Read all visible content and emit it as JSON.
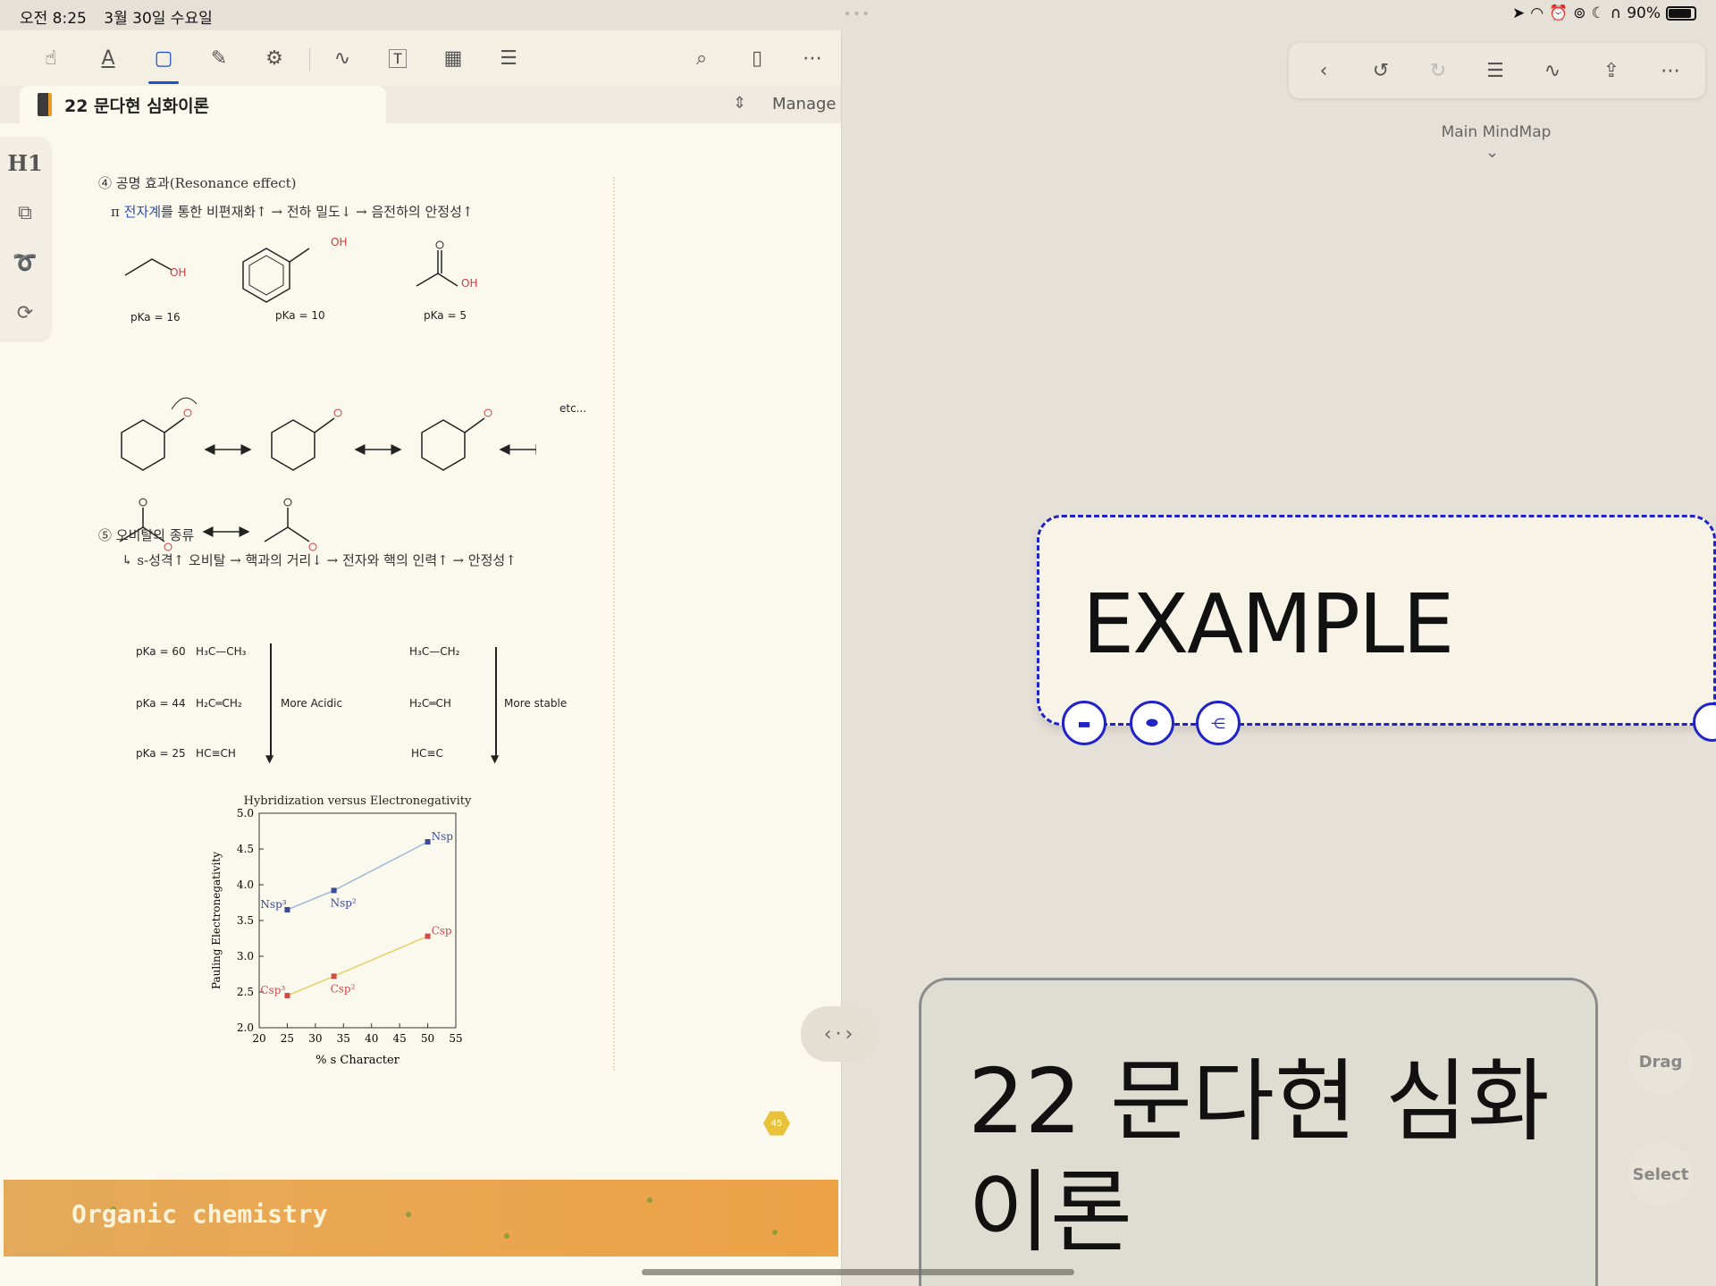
{
  "status": {
    "time": "오전 8:25",
    "date": "3월 30일 수요일",
    "battery": "90%",
    "battery_level": 0.9
  },
  "doc": {
    "tab_title": "22 문다현 심화이론",
    "manage_label": "Manage",
    "toolbar_icons": [
      "hand-icon",
      "highlighter-icon",
      "select-rect-icon",
      "shape-icon",
      "settings-icon",
      "pen-icon",
      "textbox-icon",
      "image-icon",
      "outline-icon",
      "search-icon",
      "bookmark-icon",
      "more-icon"
    ],
    "side_tools": {
      "h1": "H1"
    },
    "page": {
      "section4_title": "④ 공명 효과(Resonance effect)",
      "section4_note_prefix": "π ",
      "section4_note_blue": "전자계",
      "section4_note_rest": "를 통한 비편재화↑ → 전하 밀도↓ → 음전하의 안정성↑",
      "molecules": [
        {
          "pka": "pKa = 16",
          "oh": "OH"
        },
        {
          "pka": "pKa = 10",
          "oh": "OH"
        },
        {
          "pka": "pKa = 5",
          "oh": "OH"
        }
      ],
      "etc": "etc...",
      "section5_title": "⑤ 오비탈의 종류",
      "section5_note": "↳ s-성격↑ 오비탈 → 핵과의 거리↓ → 전자와 핵의 인력↑ → 안정성↑",
      "acid_rows": [
        {
          "pka": "pKa = 60",
          "formula": "H₃C—CH₃"
        },
        {
          "pka": "pKa = 44",
          "formula": "H₂C═CH₂"
        },
        {
          "pka": "pKa = 25",
          "formula": "HC≡CH"
        }
      ],
      "more_acidic": "More Acidic",
      "anion_rows": [
        "H₃C—CH₂",
        "H₂C═CH",
        "HC≡C"
      ],
      "more_stable": "More stable",
      "page_badge": "45"
    },
    "banner": "Organic chemistry"
  },
  "chart_data": {
    "type": "scatter",
    "title": "Hybridization versus Electronegativity",
    "xlabel": "% s Character",
    "ylabel": "Pauling Electronegativity",
    "xlim": [
      20,
      55
    ],
    "ylim": [
      2.0,
      5.0
    ],
    "xticks": [
      "20",
      "25",
      "30",
      "35",
      "40",
      "45",
      "50",
      "55"
    ],
    "yticks": [
      "2.0",
      "2.5",
      "3.0",
      "3.5",
      "4.0",
      "4.5",
      "5.0"
    ],
    "series": [
      {
        "name": "N",
        "color": "#3a4a9a",
        "line_color": "#9ab8d8",
        "points": [
          {
            "x": 25,
            "y": 3.65,
            "label": "Nsp³"
          },
          {
            "x": 33.3,
            "y": 3.92,
            "label": "Nsp²"
          },
          {
            "x": 50,
            "y": 4.6,
            "label": "Nsp"
          }
        ]
      },
      {
        "name": "C",
        "color": "#d24a4a",
        "line_color": "#e8cf66",
        "points": [
          {
            "x": 25,
            "y": 2.45,
            "label": "Csp³"
          },
          {
            "x": 33.3,
            "y": 2.72,
            "label": "Csp²"
          },
          {
            "x": 50,
            "y": 3.28,
            "label": "Csp"
          }
        ]
      }
    ]
  },
  "mindmap": {
    "map_name": "Main MindMap",
    "toolbar_icons": [
      "back-icon",
      "undo-icon",
      "redo-icon",
      "list-icon",
      "pen-icon",
      "share-icon",
      "more-icon"
    ],
    "example_node": "EXAMPLE",
    "topic_node": "22 문다현 심화이론",
    "drag_label": "Drag",
    "select_label": "Select",
    "accent": "#1f23c9"
  }
}
